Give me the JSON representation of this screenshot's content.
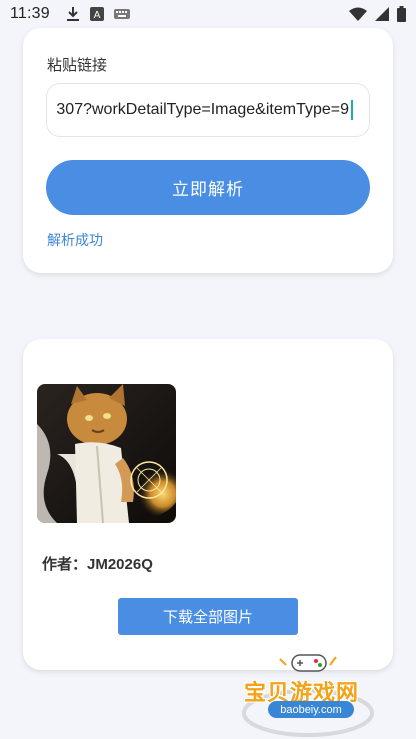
{
  "status_bar": {
    "time": "11:39",
    "icons": [
      "download-icon",
      "a-keyboard-icon",
      "keyboard-icon",
      "wifi-icon",
      "signal-icon",
      "battery-icon"
    ]
  },
  "paste_section": {
    "label": "粘贴链接",
    "input_value": "307?workDetailType=Image&itemType=9",
    "parse_button_label": "立即解析",
    "status_text": "解析成功"
  },
  "result_section": {
    "thumbnail_icon": "cat-warrior-artwork",
    "author_text": "作者：JM2026Q",
    "download_button_label": "下载全部图片"
  },
  "watermark": {
    "title": "宝贝游戏网",
    "url": "baobeiy.com"
  },
  "colors": {
    "accent": "#4a8ee3",
    "success_text": "#3f86d4",
    "background": "#f4f5fa"
  }
}
